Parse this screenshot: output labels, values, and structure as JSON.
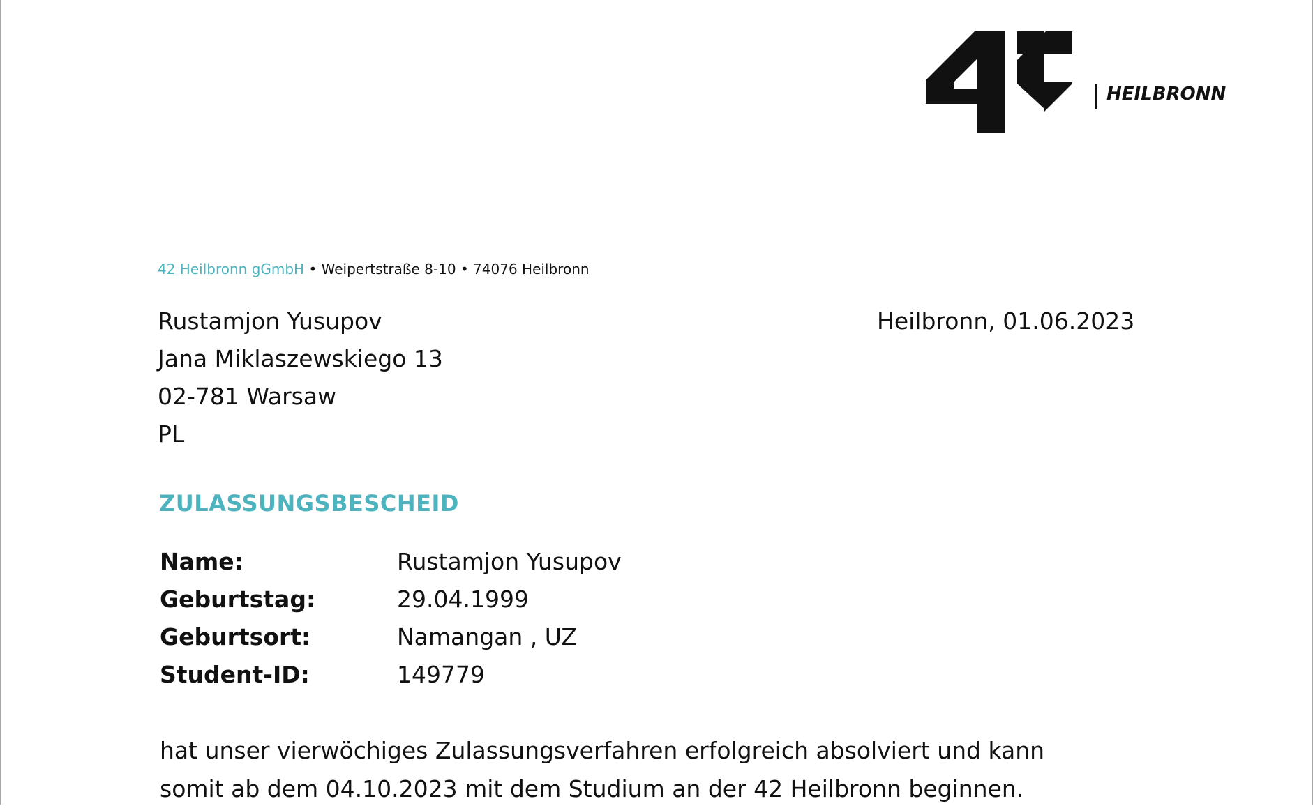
{
  "logo": {
    "brand_number": "42",
    "city": "HEILBRONN"
  },
  "sender_line": {
    "organization": "42 Heilbronn gGmbH",
    "address": " • Weipertstraße 8-10 • 74076 Heilbronn"
  },
  "recipient": [
    "Rustamjon Yusupov",
    "Jana Miklaszewskiego 13",
    "02-781 Warsaw",
    "PL"
  ],
  "date_line": "Heilbronn, 01.06.2023",
  "heading": "ZULASSUNGSBESCHEID",
  "facts": [
    {
      "label": "Name:",
      "value": "Rustamjon Yusupov"
    },
    {
      "label": "Geburtstag:",
      "value": "29.04.1999"
    },
    {
      "label": "Geburtsort:",
      "value": "Namangan , UZ"
    },
    {
      "label": "Student-ID:",
      "value": "149779"
    }
  ],
  "body_lines": [
    "hat unser vierwöchiges Zulassungsverfahren erfolgreich absolviert und kann",
    "somit ab dem 04.10.2023 mit dem Studium an der 42 Heilbronn beginnen."
  ],
  "colors": {
    "accent": "#4db4bf",
    "text": "#111111"
  }
}
